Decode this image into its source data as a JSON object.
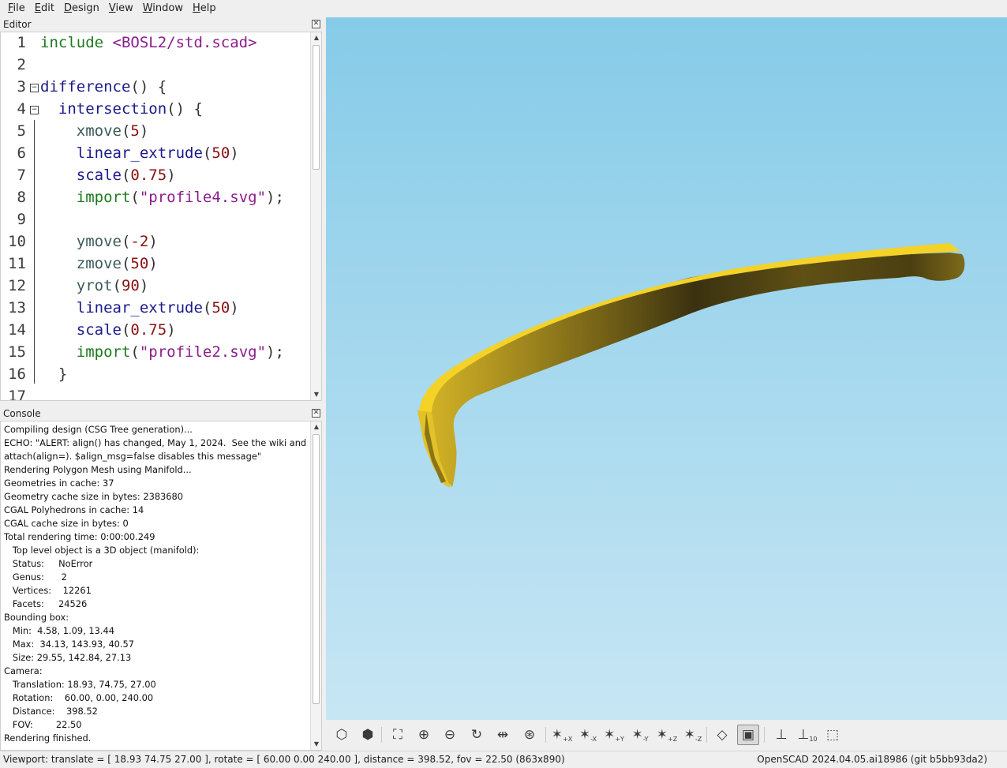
{
  "menubar": {
    "items": [
      {
        "mnemonic": "F",
        "rest": "ile"
      },
      {
        "mnemonic": "E",
        "rest": "dit"
      },
      {
        "mnemonic": "D",
        "rest": "esign"
      },
      {
        "mnemonic": "V",
        "rest": "iew"
      },
      {
        "mnemonic": "W",
        "rest": "indow"
      },
      {
        "mnemonic": "H",
        "rest": "elp"
      }
    ]
  },
  "editor": {
    "title": "Editor",
    "close_icon": "close-icon",
    "line_numbers": [
      "1",
      "2",
      "3",
      "4",
      "5",
      "6",
      "7",
      "8",
      "9",
      "10",
      "11",
      "12",
      "13",
      "14",
      "15",
      "16",
      "17"
    ],
    "code_lines": [
      [
        {
          "t": "include ",
          "c": "kw-inc"
        },
        {
          "t": "<BOSL2/std.scad>",
          "c": "kw-path"
        }
      ],
      [],
      [
        {
          "t": "difference",
          "c": "kw-fn"
        },
        {
          "t": "() {",
          "c": ""
        }
      ],
      [
        {
          "t": "  ",
          "c": ""
        },
        {
          "t": "intersection",
          "c": "kw-fn"
        },
        {
          "t": "() {",
          "c": ""
        }
      ],
      [
        {
          "t": "    ",
          "c": ""
        },
        {
          "t": "xmove",
          "c": "kw-mod"
        },
        {
          "t": "(",
          "c": ""
        },
        {
          "t": "5",
          "c": "num"
        },
        {
          "t": ")",
          "c": ""
        }
      ],
      [
        {
          "t": "    ",
          "c": ""
        },
        {
          "t": "linear_extrude",
          "c": "kw-fn"
        },
        {
          "t": "(",
          "c": ""
        },
        {
          "t": "50",
          "c": "num"
        },
        {
          "t": ")",
          "c": ""
        }
      ],
      [
        {
          "t": "    ",
          "c": ""
        },
        {
          "t": "scale",
          "c": "kw-fn"
        },
        {
          "t": "(",
          "c": ""
        },
        {
          "t": "0.75",
          "c": "num"
        },
        {
          "t": ")",
          "c": ""
        }
      ],
      [
        {
          "t": "    ",
          "c": ""
        },
        {
          "t": "import",
          "c": "kw-imp"
        },
        {
          "t": "(",
          "c": ""
        },
        {
          "t": "\"profile4.svg\"",
          "c": "str"
        },
        {
          "t": ");",
          "c": ""
        }
      ],
      [],
      [
        {
          "t": "    ",
          "c": ""
        },
        {
          "t": "ymove",
          "c": "kw-mod"
        },
        {
          "t": "(",
          "c": ""
        },
        {
          "t": "-2",
          "c": "num"
        },
        {
          "t": ")",
          "c": ""
        }
      ],
      [
        {
          "t": "    ",
          "c": ""
        },
        {
          "t": "zmove",
          "c": "kw-mod"
        },
        {
          "t": "(",
          "c": ""
        },
        {
          "t": "50",
          "c": "num"
        },
        {
          "t": ")",
          "c": ""
        }
      ],
      [
        {
          "t": "    ",
          "c": ""
        },
        {
          "t": "yrot",
          "c": "kw-mod"
        },
        {
          "t": "(",
          "c": ""
        },
        {
          "t": "90",
          "c": "num"
        },
        {
          "t": ")",
          "c": ""
        }
      ],
      [
        {
          "t": "    ",
          "c": ""
        },
        {
          "t": "linear_extrude",
          "c": "kw-fn"
        },
        {
          "t": "(",
          "c": ""
        },
        {
          "t": "50",
          "c": "num"
        },
        {
          "t": ")",
          "c": ""
        }
      ],
      [
        {
          "t": "    ",
          "c": ""
        },
        {
          "t": "scale",
          "c": "kw-fn"
        },
        {
          "t": "(",
          "c": ""
        },
        {
          "t": "0.75",
          "c": "num"
        },
        {
          "t": ")",
          "c": ""
        }
      ],
      [
        {
          "t": "    ",
          "c": ""
        },
        {
          "t": "import",
          "c": "kw-imp"
        },
        {
          "t": "(",
          "c": ""
        },
        {
          "t": "\"profile2.svg\"",
          "c": "str"
        },
        {
          "t": ");",
          "c": ""
        }
      ],
      [
        {
          "t": "  }",
          "c": ""
        }
      ],
      []
    ],
    "fold_markers": [
      "−",
      "−"
    ]
  },
  "console": {
    "title": "Console",
    "lines": [
      "Compiling design (CSG Tree generation)...",
      "ECHO: \"ALERT: align() has changed, May 1, 2024.  See the wiki and",
      "attach(align=). $align_msg=false disables this message\"",
      "Rendering Polygon Mesh using Manifold...",
      "Geometries in cache: 37",
      "Geometry cache size in bytes: 2383680",
      "CGAL Polyhedrons in cache: 14",
      "CGAL cache size in bytes: 0",
      "Total rendering time: 0:00:00.249",
      "   Top level object is a 3D object (manifold):",
      "   Status:     NoError",
      "   Genus:      2",
      "   Vertices:    12261",
      "   Facets:     24526",
      "Bounding box:",
      "   Min:  4.58, 1.09, 13.44",
      "   Max:  34.13, 143.93, 40.57",
      "   Size: 29.55, 142.84, 27.13",
      "Camera:",
      "   Translation: 18.93, 74.75, 27.00",
      "   Rotation:    60.00, 0.00, 240.00",
      "   Distance:    398.52",
      "   FOV:        22.50",
      "Rendering finished."
    ]
  },
  "toolbar": {
    "buttons": [
      {
        "name": "preview-icon",
        "label": ""
      },
      {
        "name": "render-icon",
        "label": ""
      },
      {
        "name": "view-all-icon",
        "label": ""
      },
      {
        "name": "zoom-in-icon",
        "label": ""
      },
      {
        "name": "zoom-out-icon",
        "label": ""
      },
      {
        "name": "reset-view-icon",
        "label": ""
      },
      {
        "name": "perspective-icon",
        "label": ""
      },
      {
        "name": "view-center-icon",
        "label": ""
      },
      {
        "name": "view-right-icon",
        "label": "+X"
      },
      {
        "name": "view-left-icon",
        "label": "-X"
      },
      {
        "name": "view-back-icon",
        "label": "+Y"
      },
      {
        "name": "view-front-icon",
        "label": "-Y"
      },
      {
        "name": "view-top-icon",
        "label": "+Z"
      },
      {
        "name": "view-bottom-icon",
        "label": "-Z"
      },
      {
        "name": "perspective-projection-icon",
        "label": ""
      },
      {
        "name": "orthogonal-projection-icon",
        "label": ""
      },
      {
        "name": "show-axes-icon",
        "label": ""
      },
      {
        "name": "show-scale-markers-icon",
        "label": "10"
      },
      {
        "name": "show-edges-icon",
        "label": ""
      }
    ],
    "active": "orthogonal-projection-icon"
  },
  "statusbar": {
    "left": "Viewport: translate = [ 18.93 74.75 27.00 ], rotate = [ 60.00 0.00 240.00 ], distance = 398.52, fov = 22.50 (863x890)",
    "right": "OpenSCAD 2024.04.05.ai18986 (git b5bb93da2)"
  },
  "colors": {
    "viewport_top": "#86cbe8",
    "viewport_bottom": "#c7e6f4",
    "model_light": "#f4d228",
    "model_dark": "#3e3510"
  }
}
